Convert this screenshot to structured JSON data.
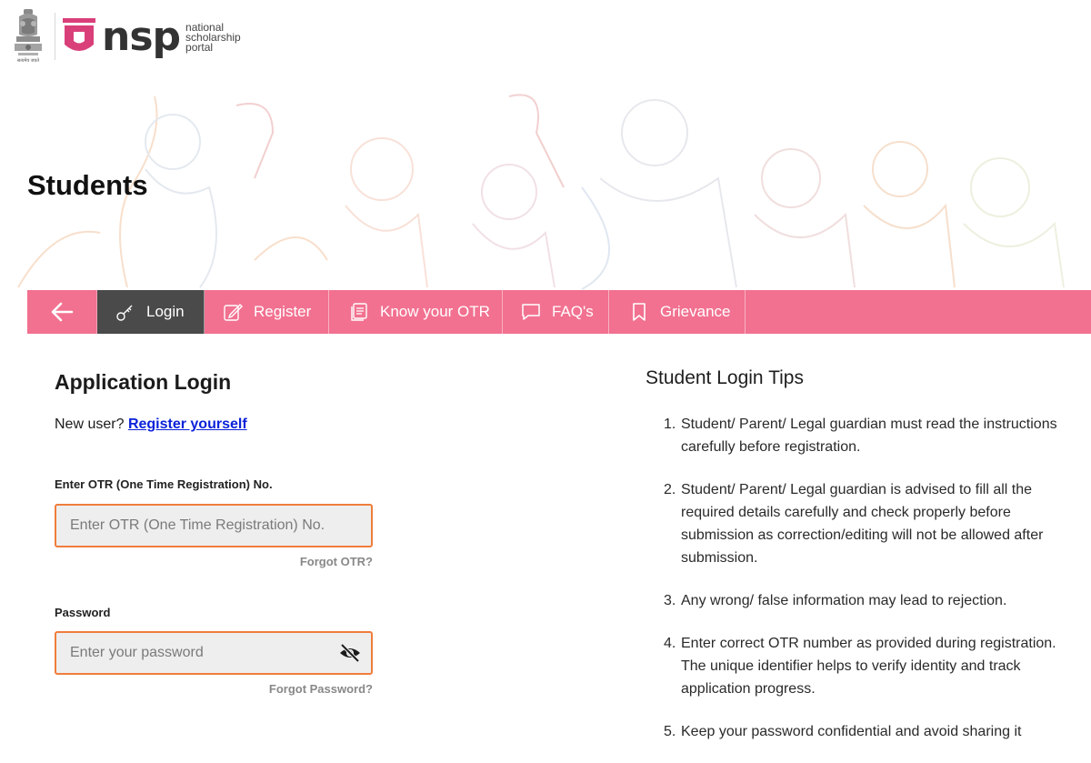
{
  "header": {
    "emblem_caption": "सत्यमेव जयते",
    "logo_word": "nsp",
    "tagline": [
      "national",
      "scholarship",
      "portal"
    ]
  },
  "banner": {
    "title": "Students"
  },
  "nav": {
    "back_icon": "arrow-left-icon",
    "items": [
      {
        "label": "Login",
        "icon": "key-icon",
        "active": true
      },
      {
        "label": "Register",
        "icon": "edit-icon",
        "active": false
      },
      {
        "label": "Know your OTR",
        "icon": "document-icon",
        "active": false
      },
      {
        "label": "FAQ's",
        "icon": "chat-icon",
        "active": false
      },
      {
        "label": "Grievance",
        "icon": "bookmark-icon",
        "active": false
      }
    ]
  },
  "login": {
    "heading": "Application Login",
    "new_user_text": "New user?",
    "register_link": "Register yourself",
    "otr_label": "Enter OTR (One Time Registration) No.",
    "otr_placeholder": "Enter OTR (One Time Registration) No.",
    "forgot_otr": "Forgot OTR?",
    "password_label": "Password",
    "password_placeholder": "Enter your password",
    "forgot_password": "Forgot Password?"
  },
  "tips": {
    "heading": "Student Login Tips",
    "items": [
      {
        "num": "1.",
        "text": "Student/ Parent/ Legal guardian must read the instructions carefully before registration."
      },
      {
        "num": "2.",
        "text": "Student/ Parent/ Legal guardian is advised to fill all the required details carefully and check properly before submission as correction/editing will not be allowed after submission."
      },
      {
        "num": "3.",
        "text": "Any wrong/ false information may lead to rejection."
      },
      {
        "num": "4.",
        "text": "Enter correct OTR number as provided during registration. The unique identifier helps to verify identity and track application progress."
      },
      {
        "num": "5.",
        "text": "Keep your password confidential and avoid sharing it"
      }
    ]
  },
  "colors": {
    "nav_bg": "#f27190",
    "nav_active": "#4a4a4a",
    "field_border": "#f07d3c",
    "link": "#0b22d9",
    "brand_pink": "#d9407a"
  }
}
